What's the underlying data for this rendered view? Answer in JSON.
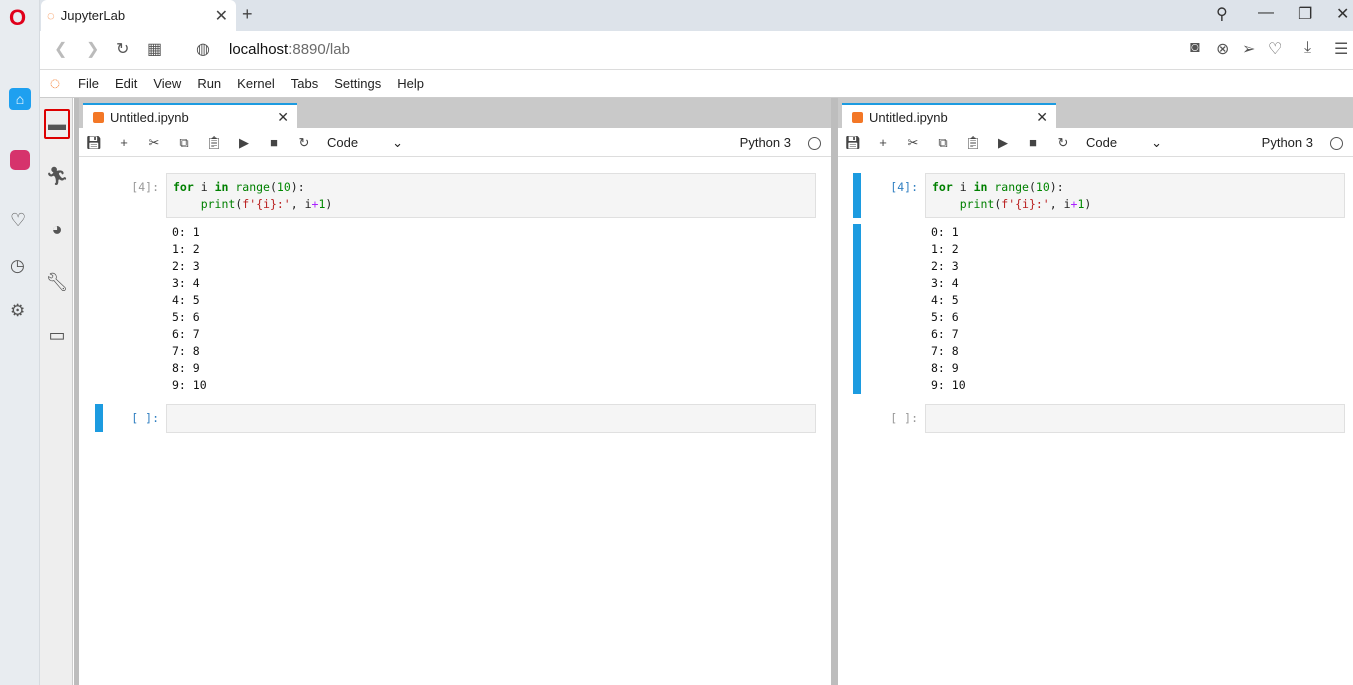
{
  "browser": {
    "tab_title": "JupyterLab",
    "url_host": "localhost",
    "url_rest": ":8890/lab"
  },
  "jupyter": {
    "menu": [
      "File",
      "Edit",
      "View",
      "Run",
      "Kernel",
      "Tabs",
      "Settings",
      "Help"
    ],
    "left_panel": {
      "tab_title": "Untitled.ipynb",
      "cell_type": "Code",
      "kernel": "Python 3",
      "code_prompt": "[4]:",
      "code": [
        "for i in range(10):",
        "    print(f'{i}:', i+1)"
      ],
      "outputs": [
        "0: 1",
        "1: 2",
        "2: 3",
        "3: 4",
        "4: 5",
        "5: 6",
        "6: 7",
        "7: 8",
        "8: 9",
        "9: 10"
      ],
      "empty_prompt": "[ ]:"
    },
    "right_panel": {
      "tab_title": "Untitled.ipynb",
      "cell_type": "Code",
      "kernel": "Python 3",
      "code_prompt": "[4]:",
      "outputs": [
        "0: 1",
        "1: 2",
        "2: 3",
        "3: 4",
        "4: 5",
        "5: 6",
        "6: 7",
        "7: 8",
        "8: 9",
        "9: 10"
      ],
      "empty_prompt": "[ ]:"
    }
  },
  "colors": {
    "accent": "#1c9be0",
    "jupyter_orange": "#f37726"
  }
}
